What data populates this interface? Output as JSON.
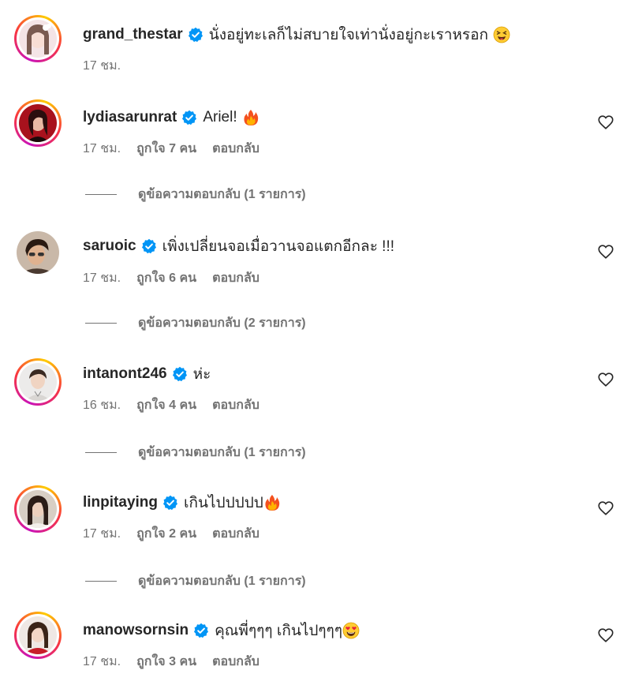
{
  "comments": [
    {
      "username": "grand_thestar",
      "text": "นั่งอยู่ทะเลก็ไม่สบายใจเท่านั่งอยู่กะเราหรอก",
      "emoji": "squinting-tongue-emoji",
      "time": "17 ชม.",
      "likes": "",
      "reply": "",
      "view_replies": "",
      "story_ring": true,
      "avatar_color": "#f2d9dc"
    },
    {
      "username": "lydiasarunrat",
      "text": "Ariel!",
      "emoji": "fire-emoji",
      "time": "17 ชม.",
      "likes": "ถูกใจ 7 คน",
      "reply": "ตอบกลับ",
      "view_replies": "ดูข้อความตอบกลับ (1 รายการ)",
      "story_ring": true,
      "avatar_color": "#a8121d"
    },
    {
      "username": "saruoic",
      "text": "เพิ่งเปลี่ยนจอเมื่อวานจอแตกอีกละ !!!",
      "emoji": "",
      "time": "17 ชม.",
      "likes": "ถูกใจ 6 คน",
      "reply": "ตอบกลับ",
      "view_replies": "ดูข้อความตอบกลับ (2 รายการ)",
      "story_ring": false,
      "avatar_color": "#6b4a3a"
    },
    {
      "username": "intanont246",
      "text": "ห่ะ",
      "emoji": "",
      "time": "16 ชม.",
      "likes": "ถูกใจ 4 คน",
      "reply": "ตอบกลับ",
      "view_replies": "ดูข้อความตอบกลับ (1 รายการ)",
      "story_ring": true,
      "avatar_color": "#e6e4e2"
    },
    {
      "username": "linpitaying",
      "text": "เกินไปปปปป",
      "emoji": "fire-emoji",
      "time": "17 ชม.",
      "likes": "ถูกใจ 2 คน",
      "reply": "ตอบกลับ",
      "view_replies": "ดูข้อความตอบกลับ (1 รายการ)",
      "story_ring": true,
      "avatar_color": "#d8cfc4"
    },
    {
      "username": "manowsornsin",
      "text": "คุณพี่ๆๆๆ เกินไปๆๆๆ",
      "emoji": "heart-eyes-emoji",
      "time": "17 ชม.",
      "likes": "ถูกใจ 3 คน",
      "reply": "ตอบกลับ",
      "view_replies": "",
      "story_ring": true,
      "avatar_color": "#c81e2a"
    }
  ],
  "colors": {
    "verified_badge": "#0095f6",
    "meta_text": "#737373",
    "primary_text": "#262626"
  }
}
